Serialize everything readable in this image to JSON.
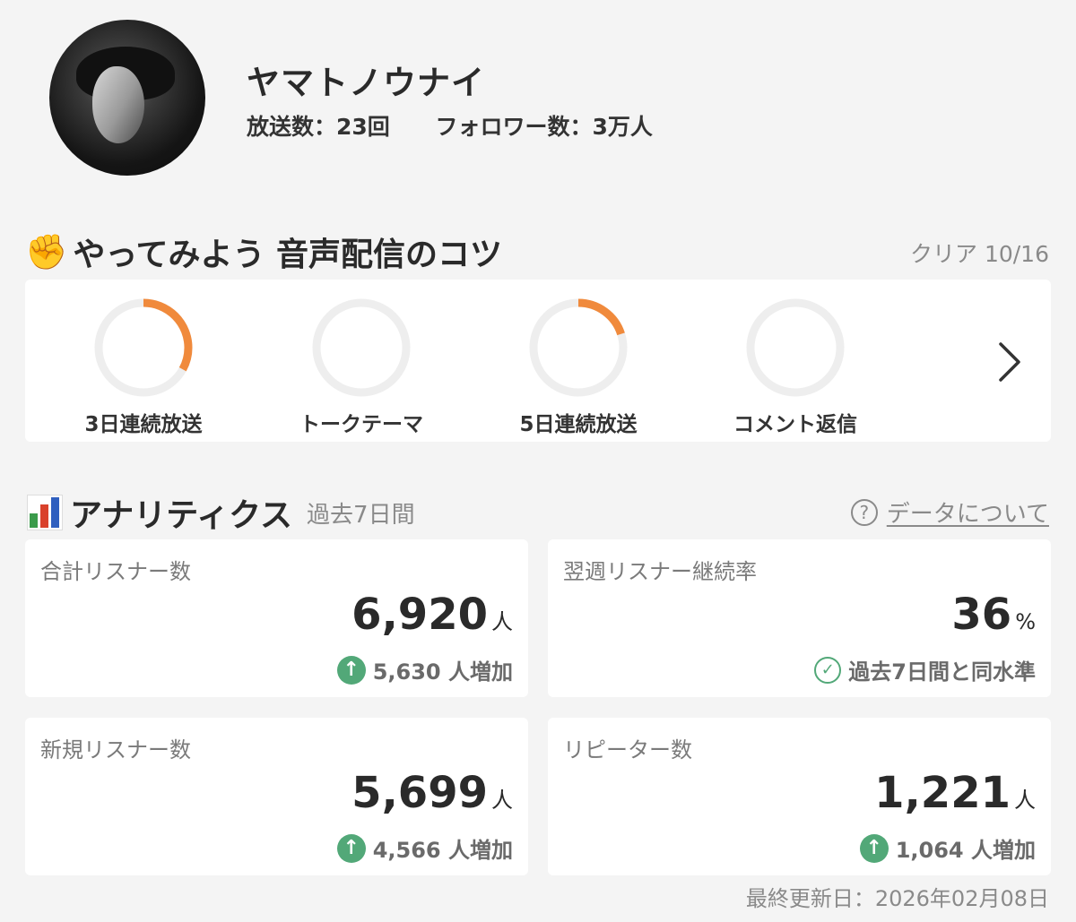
{
  "profile": {
    "name": "ヤマトノウナイ",
    "broadcasts": "放送数：23回",
    "followers": "フォロワー数：3万人"
  },
  "tips": {
    "emoji": "✊",
    "title": "やってみよう 音声配信のコツ",
    "clear": "クリア 10/16",
    "accent_color": "#f08a3c",
    "track_color": "#eeeeee",
    "items": [
      {
        "label": "3日連続放送",
        "progress": 0.33
      },
      {
        "label": "トークテーマ",
        "progress": 0
      },
      {
        "label": "5日連続放送",
        "progress": 0.2
      },
      {
        "label": "コメント返信",
        "progress": 0
      }
    ],
    "next_icon": "chevron-right-icon"
  },
  "analytics": {
    "title": "アナリティクス",
    "period": "過去7日間",
    "about_link": "データについて",
    "up_color": "#52a878",
    "cards": [
      {
        "label": "合計リスナー数",
        "value": "6,920",
        "unit": "人",
        "delta": "5,630 人増加",
        "delta_type": "up"
      },
      {
        "label": "翌週リスナー継続率",
        "value": "36",
        "unit": "%",
        "delta": "過去7日間と同水準",
        "delta_type": "same"
      },
      {
        "label": "新規リスナー数",
        "value": "5,699",
        "unit": "人",
        "delta": "4,566 人増加",
        "delta_type": "up"
      },
      {
        "label": "リピーター数",
        "value": "1,221",
        "unit": "人",
        "delta": "1,064 人増加",
        "delta_type": "up"
      }
    ]
  },
  "last_updated": "最終更新日：2026年02月08日"
}
